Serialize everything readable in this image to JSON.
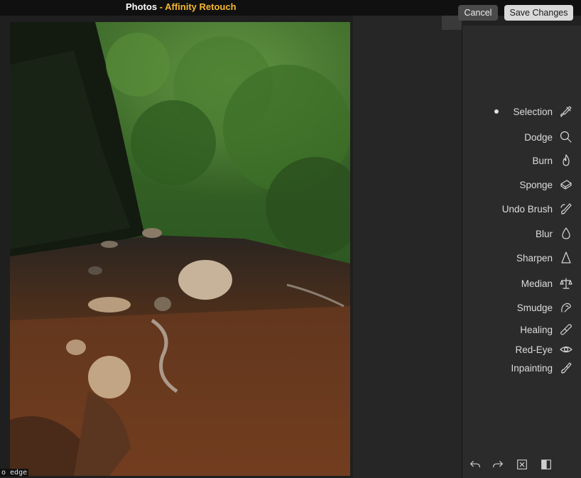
{
  "window": {
    "title_app": "Photos",
    "title_sep": " - ",
    "title_ext": "Affinity Retouch"
  },
  "header": {
    "cancel_label": "Cancel",
    "save_label": "Save Changes"
  },
  "tools": [
    {
      "label": "Selection",
      "icon": "selection-brush-icon",
      "selected": true
    },
    {
      "label": "Dodge",
      "icon": "magnifier-icon"
    },
    {
      "label": "Burn",
      "icon": "flame-icon"
    },
    {
      "label": "Sponge",
      "icon": "sponge-icon"
    },
    {
      "label": "Undo Brush",
      "icon": "undo-brush-icon"
    },
    {
      "label": "Blur",
      "icon": "droplet-icon"
    },
    {
      "label": "Sharpen",
      "icon": "triangle-icon"
    },
    {
      "label": "Median",
      "icon": "scales-icon"
    },
    {
      "label": "Smudge",
      "icon": "finger-icon"
    },
    {
      "label": "Healing",
      "icon": "bandage-icon"
    },
    {
      "label": "Red-Eye",
      "icon": "eye-icon"
    },
    {
      "label": "Inpainting",
      "icon": "inpaint-brush-icon"
    }
  ],
  "footer": {
    "icons": [
      "undo-icon",
      "redo-icon",
      "clear-icon",
      "before-after-icon"
    ]
  },
  "canvas": {
    "edge_text": "o edge"
  },
  "colors": {
    "accent": "#f5b830",
    "panel": "#2b2b2b"
  }
}
